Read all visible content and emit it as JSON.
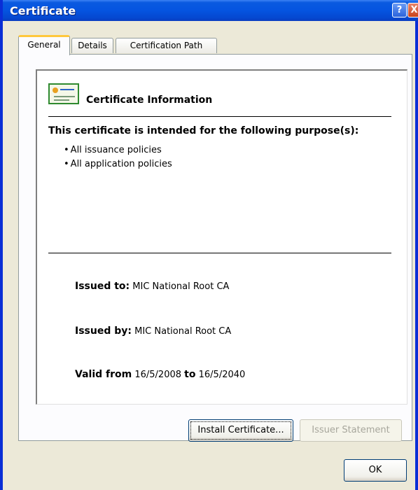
{
  "window": {
    "title": "Certificate"
  },
  "titlebar": {
    "help_glyph": "?",
    "close_glyph": "X"
  },
  "tabs": [
    {
      "label": "General",
      "active": true
    },
    {
      "label": "Details",
      "active": false
    },
    {
      "label": "Certification Path",
      "active": false
    }
  ],
  "info": {
    "heading": "Certificate Information",
    "purpose_title": "This certificate is intended for the following purpose(s):",
    "purposes": [
      "All issuance policies",
      "All application policies"
    ],
    "issued_to_label": "Issued to:",
    "issued_to_value": "MIC National Root CA",
    "issued_by_label": "Issued by:",
    "issued_by_value": "MIC National Root CA",
    "valid_from_label": "Valid from",
    "valid_from_value": "16/5/2008",
    "valid_to_label": "to",
    "valid_to_value": "16/5/2040"
  },
  "buttons": {
    "install": "Install Certificate...",
    "issuer": "Issuer Statement",
    "ok": "OK"
  },
  "icons": {
    "certificate": "certificate-icon",
    "help": "help-icon",
    "close": "close-icon"
  },
  "colors": {
    "titlebar": "#0554e0",
    "tab_highlight": "#ffc83c",
    "window_bg": "#ece9d8"
  }
}
